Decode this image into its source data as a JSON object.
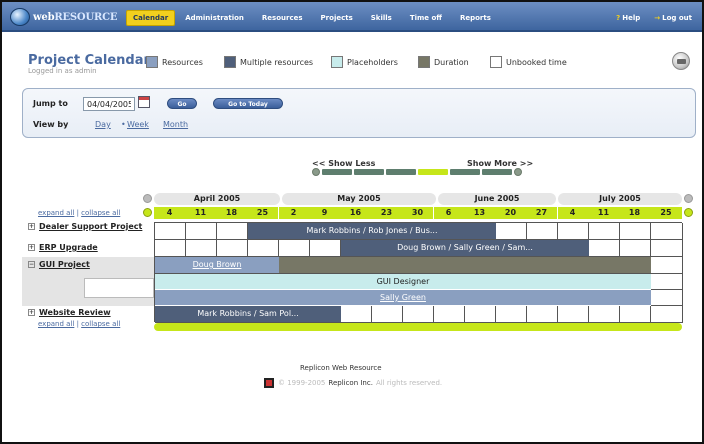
{
  "app": {
    "logo_web": "web",
    "logo_resource": "RESOURCE",
    "nav": [
      "Calendar",
      "Administration",
      "Resources",
      "Projects",
      "Skills",
      "Time off",
      "Reports"
    ],
    "help": "Help",
    "logout": "Log out"
  },
  "page": {
    "title": "Project Calendar",
    "subtitle": "Logged in as admin"
  },
  "legend": [
    {
      "label": "Resources",
      "color": "#8a9fc0"
    },
    {
      "label": "Multiple resources",
      "color": "#4f5f7a"
    },
    {
      "label": "Placeholders",
      "color": "#c8ecec"
    },
    {
      "label": "Duration",
      "color": "#777766"
    },
    {
      "label": "Unbooked time",
      "color": "#ffffff"
    }
  ],
  "jump": {
    "label": "Jump to",
    "date": "04/04/2005",
    "go": "Go",
    "today": "Go to Today",
    "view_label": "View by",
    "views": [
      "Day",
      "Week",
      "Month"
    ],
    "selected_view": "Week"
  },
  "zoom": {
    "less": "<< Show Less",
    "more": "Show More >>"
  },
  "calendar": {
    "months": [
      "April 2005",
      "May 2005",
      "June 2005",
      "July 2005"
    ],
    "weeks": [
      "4",
      "11",
      "18",
      "25",
      "2",
      "9",
      "16",
      "23",
      "30",
      "6",
      "13",
      "20",
      "27",
      "4",
      "11",
      "18",
      "25"
    ],
    "expand_all": "expand all",
    "collapse_all": "collapse all",
    "rows": [
      {
        "name": "Dealer Support Project",
        "bar": "Mark Robbins / Rob Jones / Bus..."
      },
      {
        "name": "ERP Upgrade",
        "bar": "Doug Brown / Sally Green / Sam..."
      },
      {
        "name": "GUI Project",
        "bar1": "Doug Brown",
        "bar2": "GUI Designer",
        "bar3": "Sally Green"
      },
      {
        "name": "Website Review",
        "bar": "Mark Robbins / Sam Pol..."
      }
    ]
  },
  "footer": {
    "line1": "Replicon Web Resource",
    "copyright": "© 1999-2005",
    "company": "Replicon Inc.",
    "rights": "All rights reserved."
  }
}
